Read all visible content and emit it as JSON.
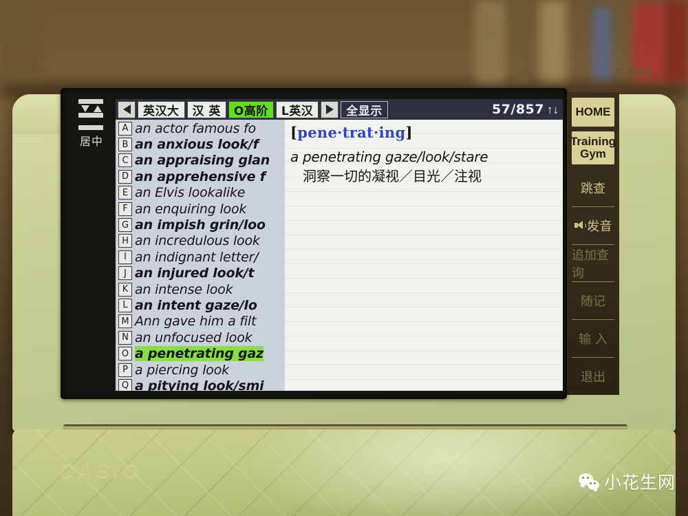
{
  "scene": {
    "device_brand": "CASIO",
    "device_model": "E-R99"
  },
  "colors": {
    "active_tab_green": "#5ee11b",
    "selection_green": "#86e043",
    "headword_blue": "#2f46c8",
    "lcd_background": "#e9eae4",
    "list_background": "#ccd2dc",
    "tabbar_background": "#2d3040",
    "sidebar_background": "#332c1a",
    "sidebar_key_cream": "#d9cf97",
    "case_green": "#c3cb90"
  },
  "left_rail": {
    "icon": "center-align-icon",
    "label": "居中"
  },
  "tabbar": {
    "prev_icon": "triangle-left-icon",
    "next_icon": "triangle-right-icon",
    "tabs": [
      {
        "label": "英汉大",
        "active": false
      },
      {
        "label": "汉 英",
        "active": false
      },
      {
        "label": "O高阶",
        "active": true
      },
      {
        "label": "L英汉",
        "active": false
      }
    ],
    "display_mode": "全显示",
    "page_count": "57/857",
    "scroll_indicator": "↑↓"
  },
  "list": {
    "items": [
      {
        "key": "A",
        "text": "an actor famous fo",
        "bold": false,
        "selected": false
      },
      {
        "key": "B",
        "text": "an anxious look/f",
        "bold": true,
        "selected": false
      },
      {
        "key": "C",
        "text": "an appraising glan",
        "bold": true,
        "selected": false
      },
      {
        "key": "D",
        "text": "an apprehensive f",
        "bold": true,
        "selected": false
      },
      {
        "key": "E",
        "text": "an Elvis lookalike",
        "bold": false,
        "selected": false
      },
      {
        "key": "F",
        "text": "an enquiring look",
        "bold": false,
        "selected": false
      },
      {
        "key": "G",
        "text": "an impish grin/loo",
        "bold": true,
        "selected": false
      },
      {
        "key": "H",
        "text": "an incredulous look",
        "bold": false,
        "selected": false
      },
      {
        "key": "I",
        "text": "an indignant letter/",
        "bold": false,
        "selected": false
      },
      {
        "key": "J",
        "text": "an injured look/t",
        "bold": true,
        "selected": false
      },
      {
        "key": "K",
        "text": "an intense look",
        "bold": false,
        "selected": false
      },
      {
        "key": "L",
        "text": "an intent gaze/lo",
        "bold": true,
        "selected": false
      },
      {
        "key": "M",
        "text": "Ann gave him a filt",
        "bold": false,
        "selected": false
      },
      {
        "key": "N",
        "text": "an unfocused look",
        "bold": false,
        "selected": false
      },
      {
        "key": "O",
        "text": "a penetrating gaz",
        "bold": true,
        "selected": true
      },
      {
        "key": "P",
        "text": "a piercing look",
        "bold": false,
        "selected": false
      },
      {
        "key": "Q",
        "text": "a pitying look/smi",
        "bold": true,
        "selected": false
      }
    ]
  },
  "definition": {
    "bracket_open": "[",
    "headword": "pene·trat·ing",
    "bracket_close": "]",
    "example": "a penetrating gaze/look/stare",
    "gloss": "洞察一切的凝视／目光／注视"
  },
  "sidebar": {
    "keys": [
      {
        "name": "home",
        "line1": "HOME",
        "line2": ""
      },
      {
        "name": "training-gym",
        "line1": "Training",
        "line2": "Gym"
      }
    ],
    "items": [
      {
        "name": "jump-search",
        "label": "跳查",
        "icon": "",
        "dim": false
      },
      {
        "name": "pronounce",
        "label": "发音",
        "icon": "speaker-icon",
        "dim": false
      },
      {
        "name": "additional-query",
        "label": "追加查询",
        "icon": "",
        "dim": true
      },
      {
        "name": "notes",
        "label": "随记",
        "icon": "",
        "dim": true
      },
      {
        "name": "input",
        "label": "输 入",
        "icon": "",
        "dim": true
      },
      {
        "name": "exit",
        "label": "退出",
        "icon": "",
        "dim": true
      }
    ]
  },
  "watermark": {
    "icon": "wechat-icon",
    "text": "小花生网"
  }
}
